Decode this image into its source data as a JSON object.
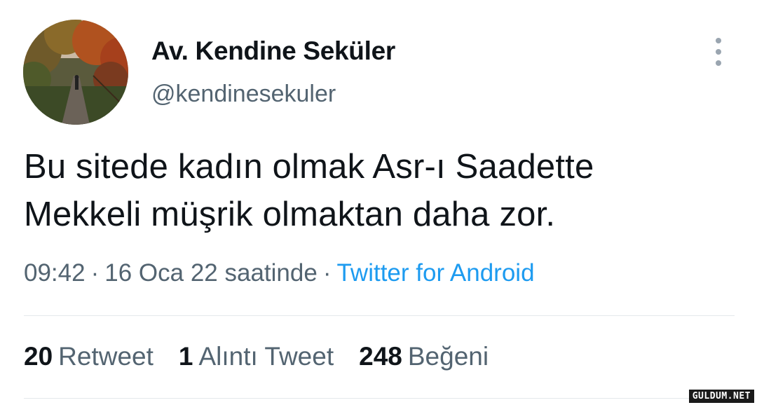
{
  "user": {
    "display_name": "Av. Kendine Seküler",
    "handle": "@kendinesekuler",
    "avatar_icon": "avatar-photo-autumn-path"
  },
  "menu": {
    "icon": "more-vertical-icon"
  },
  "tweet": {
    "text": "Bu sitede kadın olmak Asr-ı Saadette\nMekkeli müşrik olmaktan daha zor.",
    "time": "09:42",
    "separator": "·",
    "date": "16 Oca 22 saatinde",
    "source": "Twitter for Android"
  },
  "stats": {
    "retweets_count": "20",
    "retweets_label": "Retweet",
    "quotes_count": "1",
    "quotes_label": "Alıntı Tweet",
    "likes_count": "248",
    "likes_label": "Beğeni"
  },
  "watermark": "GULDUM.NET",
  "colors": {
    "text": "#0f1419",
    "secondary": "#536471",
    "link": "#1d9bf0",
    "divider": "#e4e8eb"
  }
}
